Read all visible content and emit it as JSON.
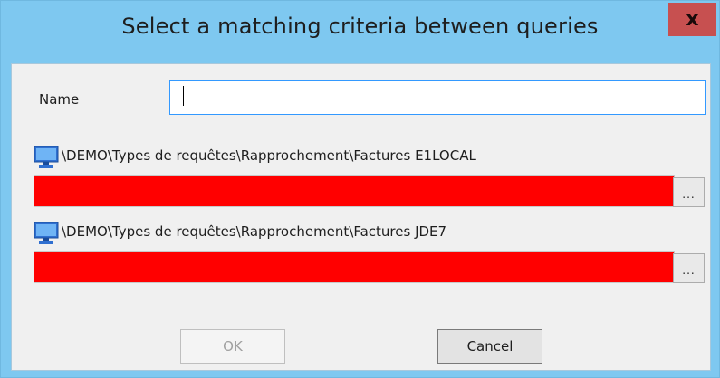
{
  "dialog": {
    "title": "Select a matching criteria between queries",
    "close_label": "x"
  },
  "form": {
    "name_label": "Name",
    "name_value": ""
  },
  "queries": [
    {
      "path": "\\DEMO\\Types de requêtes\\Rapprochement\\Factures E1LOCAL",
      "browse_label": "..."
    },
    {
      "path": "\\DEMO\\Types de requêtes\\Rapprochement\\Factures JDE7",
      "browse_label": "..."
    }
  ],
  "buttons": {
    "ok_label": "OK",
    "cancel_label": "Cancel"
  },
  "colors": {
    "titlebar": "#7ec8f0",
    "close": "#c75050",
    "error_field": "#ff0000"
  },
  "icons": {
    "query": "monitor-icon"
  }
}
